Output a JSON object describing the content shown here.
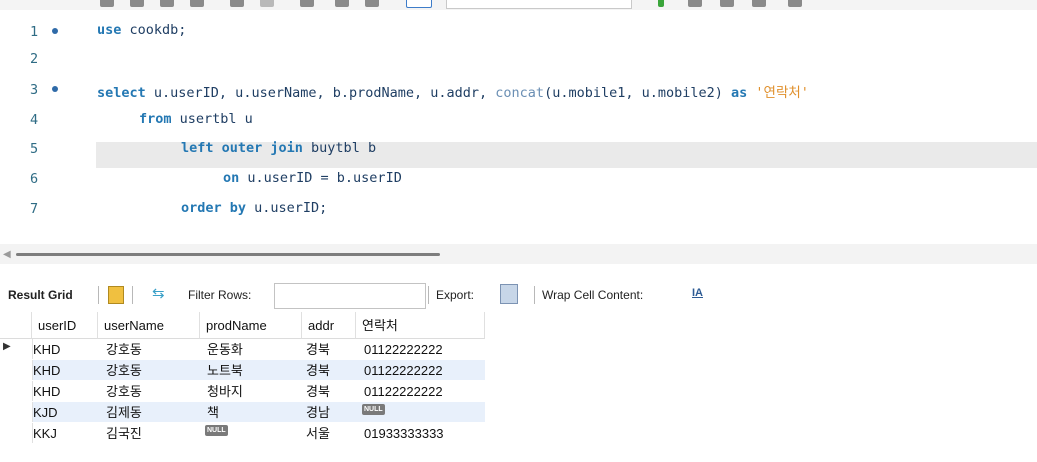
{
  "editor": {
    "lines": [
      {
        "num": "1",
        "marker": true
      },
      {
        "num": "2",
        "marker": false
      },
      {
        "num": "3",
        "marker": true
      },
      {
        "num": "4",
        "marker": false
      },
      {
        "num": "5",
        "marker": false
      },
      {
        "num": "6",
        "marker": false
      },
      {
        "num": "7",
        "marker": false
      }
    ],
    "l1": {
      "kw": "use",
      "rest": " cookdb;"
    },
    "l3": {
      "kw1": "select",
      "t1": " u.userID, u.userName, b.prodName, u.addr, ",
      "fn": "concat",
      "t2": "(u.mobile1, u.mobile2) ",
      "kw2": "as",
      "str": " '연락처'"
    },
    "l4": {
      "kw": "from",
      "rest": " usertbl u"
    },
    "l5": {
      "kw": "left outer join",
      "rest": " buytbl b"
    },
    "l6": {
      "kw": "on",
      "rest": " u.userID = b.userID"
    },
    "l7": {
      "kw": "order by",
      "rest": " u.userID;"
    }
  },
  "result_toolbar": {
    "result_grid_label": "Result Grid",
    "filter_rows_label": "Filter Rows:",
    "filter_value": "",
    "export_label": "Export:",
    "wrap_label": "Wrap Cell Content:"
  },
  "grid": {
    "columns": [
      "userID",
      "userName",
      "prodName",
      "addr",
      "연락처"
    ],
    "null_text": "NULL",
    "rows": [
      {
        "userID": "KHD",
        "userName": "강호동",
        "prodName": "운동화",
        "addr": "경북",
        "contact": "01122222222",
        "prod_null": false,
        "contact_null": false
      },
      {
        "userID": "KHD",
        "userName": "강호동",
        "prodName": "노트북",
        "addr": "경북",
        "contact": "01122222222",
        "prod_null": false,
        "contact_null": false
      },
      {
        "userID": "KHD",
        "userName": "강호동",
        "prodName": "청바지",
        "addr": "경북",
        "contact": "01122222222",
        "prod_null": false,
        "contact_null": false
      },
      {
        "userID": "KJD",
        "userName": "김제동",
        "prodName": "책",
        "addr": "경남",
        "contact": "",
        "prod_null": false,
        "contact_null": true
      },
      {
        "userID": "KKJ",
        "userName": "김국진",
        "prodName": "",
        "addr": "서울",
        "contact": "01933333333",
        "prod_null": true,
        "contact_null": false
      }
    ]
  }
}
